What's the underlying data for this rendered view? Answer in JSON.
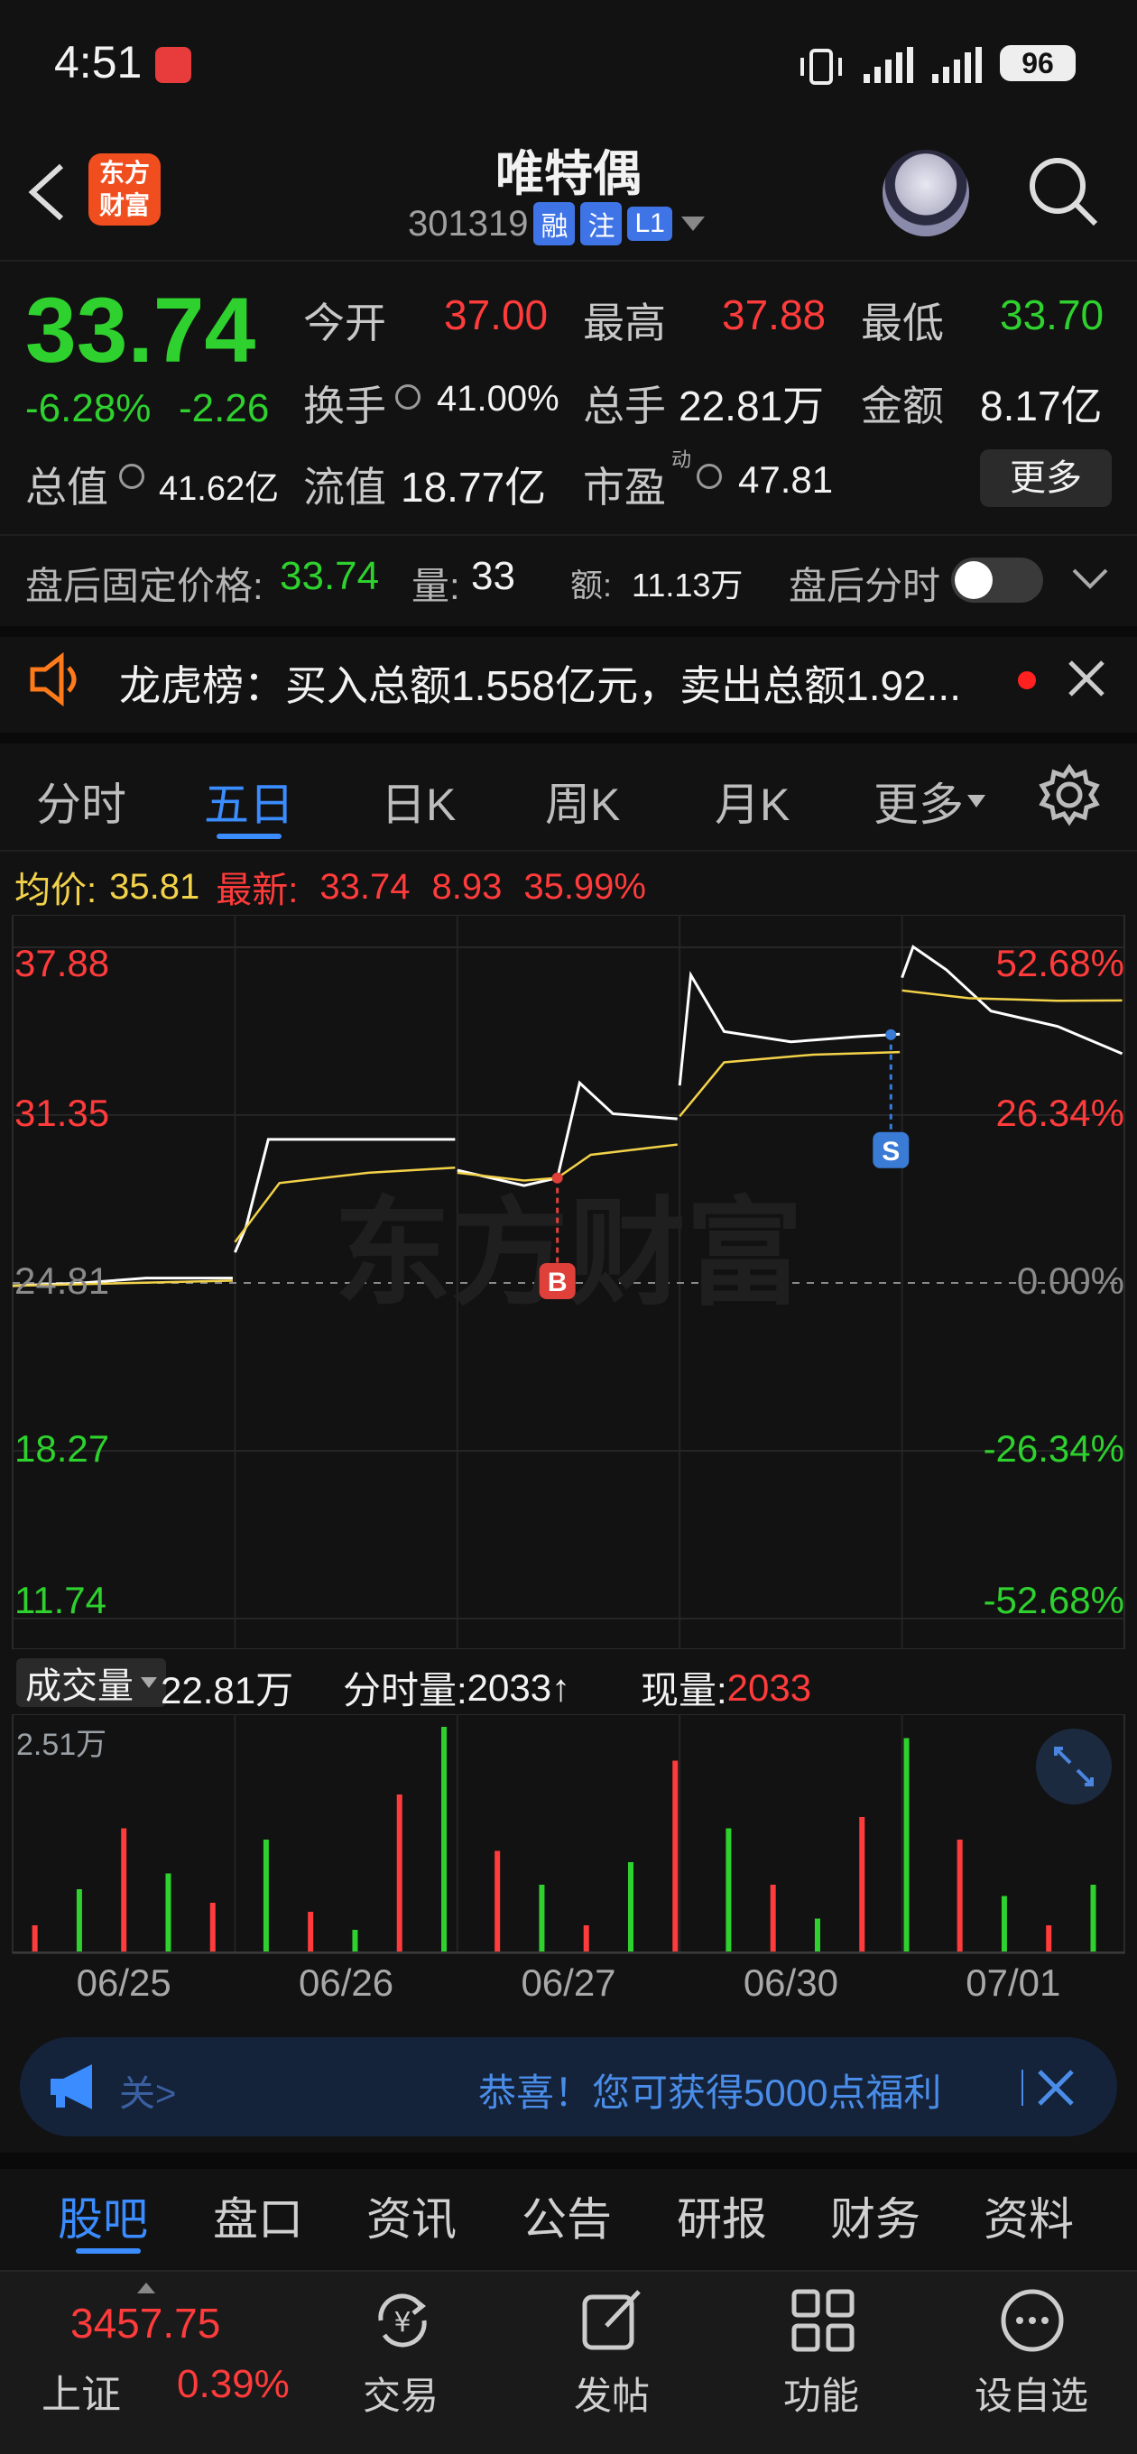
{
  "status_bar": {
    "time": "4:51",
    "battery": "96"
  },
  "header": {
    "title": "唯特偶",
    "code": "301319",
    "badges": [
      "融",
      "注",
      "L1"
    ]
  },
  "quote": {
    "price": "33.74",
    "pct": "-6.28%",
    "change": "-2.26",
    "open_label": "今开",
    "open": "37.00",
    "high_label": "最高",
    "high": "37.88",
    "low_label": "最低",
    "low": "33.70",
    "turnover_label": "换手",
    "turnover": "41.00%",
    "volume_label": "总手",
    "volume": "22.81万",
    "amount_label": "金额",
    "amount": "8.17亿",
    "mktcap_label": "总值",
    "mktcap": "41.62亿",
    "float_label": "流值",
    "float": "18.77亿",
    "pe_label": "市盈",
    "pe_sup": "动",
    "pe": "47.81",
    "more": "更多"
  },
  "after_hours": {
    "label": "盘后固定价格:",
    "price": "33.74",
    "vol_label": "量:",
    "vol": "33",
    "amt_label": "额:",
    "amt": "11.13万",
    "toggle_label": "盘后分时"
  },
  "notice": {
    "text": "龙虎榜：买入总额1.558亿元，卖出总额1.92..."
  },
  "chart_tabs": [
    "分时",
    "五日",
    "日K",
    "周K",
    "月K",
    "更多"
  ],
  "chart_info": {
    "avg_label": "均价:",
    "avg": "35.81",
    "latest_label": "最新:",
    "latest": "33.74",
    "chg": "8.93",
    "pct": "35.99%"
  },
  "chart_data": {
    "type": "line",
    "x": [
      "06/25",
      "06/26",
      "06/27",
      "06/30",
      "07/01"
    ],
    "y_labels_left": [
      "37.88",
      "31.35",
      "24.81",
      "18.27",
      "11.74"
    ],
    "y_labels_right": [
      "52.68%",
      "26.34%",
      "0.00%",
      "-26.34%",
      "-52.68%"
    ],
    "ylim": [
      11.74,
      37.88
    ],
    "series": [
      {
        "values": [
          [
            0,
            24.7
          ],
          [
            0.3,
            24.8
          ],
          [
            0.6,
            25.0
          ],
          [
            0.99,
            25.0
          ],
          [
            1.0,
            26.0
          ],
          [
            1.05,
            27.0
          ],
          [
            1.15,
            30.4
          ],
          [
            1.5,
            30.4
          ],
          [
            1.99,
            30.4
          ],
          [
            2.0,
            29.2
          ],
          [
            2.3,
            28.6
          ],
          [
            2.45,
            28.9
          ],
          [
            2.55,
            32.6
          ],
          [
            2.7,
            31.4
          ],
          [
            2.99,
            31.2
          ],
          [
            3.0,
            32.5
          ],
          [
            3.05,
            36.8
          ],
          [
            3.2,
            34.6
          ],
          [
            3.5,
            34.2
          ],
          [
            3.8,
            34.4
          ],
          [
            3.99,
            34.5
          ],
          [
            4.0,
            36.7
          ],
          [
            4.05,
            37.9
          ],
          [
            4.2,
            37.0
          ],
          [
            4.4,
            35.4
          ],
          [
            4.7,
            34.8
          ],
          [
            4.99,
            33.74
          ]
        ]
      },
      {
        "values": [
          [
            0,
            24.7
          ],
          [
            0.5,
            24.8
          ],
          [
            0.99,
            24.9
          ],
          [
            1.0,
            26.4
          ],
          [
            1.2,
            28.7
          ],
          [
            1.6,
            29.1
          ],
          [
            1.99,
            29.3
          ],
          [
            2.0,
            29.1
          ],
          [
            2.3,
            28.8
          ],
          [
            2.45,
            28.9
          ],
          [
            2.6,
            29.8
          ],
          [
            2.99,
            30.2
          ],
          [
            3.0,
            31.3
          ],
          [
            3.2,
            33.4
          ],
          [
            3.6,
            33.7
          ],
          [
            3.99,
            33.8
          ],
          [
            4.0,
            36.2
          ],
          [
            4.3,
            35.9
          ],
          [
            4.7,
            35.8
          ],
          [
            4.99,
            35.81
          ]
        ]
      }
    ],
    "markers": [
      {
        "label": "B",
        "day": 2.45
      },
      {
        "label": "S",
        "day": 3.95
      }
    ],
    "watermark": "东方财富"
  },
  "volume_bar": {
    "label": "成交量",
    "total": "22.81万",
    "period_label": "分时量:",
    "period": "2033",
    "arrow": "↑",
    "current_label": "现量:",
    "current": "2033",
    "max": "2.51万"
  },
  "volume_data": {
    "values": [
      0.12,
      0.28,
      0.55,
      0.35,
      0.22,
      0.5,
      0.18,
      0.1,
      0.7,
      1.0,
      0.45,
      0.3,
      0.12,
      0.4,
      0.85,
      0.55,
      0.3,
      0.15,
      0.6,
      0.95,
      0.5,
      0.25,
      0.12,
      0.3
    ]
  },
  "banner": {
    "link": "关>",
    "text": "恭喜！您可获得5000点福利"
  },
  "bottom_tabs": [
    "股吧",
    "盘口",
    "资讯",
    "公告",
    "研报",
    "财务",
    "资料"
  ],
  "nav": {
    "index_value": "3457.75",
    "index_name": "上证",
    "index_pct": "0.39%",
    "items": [
      "交易",
      "发帖",
      "功能",
      "设自选"
    ]
  },
  "colors": {
    "up": "#ff3b3b",
    "down": "#2ed12e",
    "accent": "#3b8cff",
    "avg_line": "#f3d24a",
    "background": "#121212"
  }
}
